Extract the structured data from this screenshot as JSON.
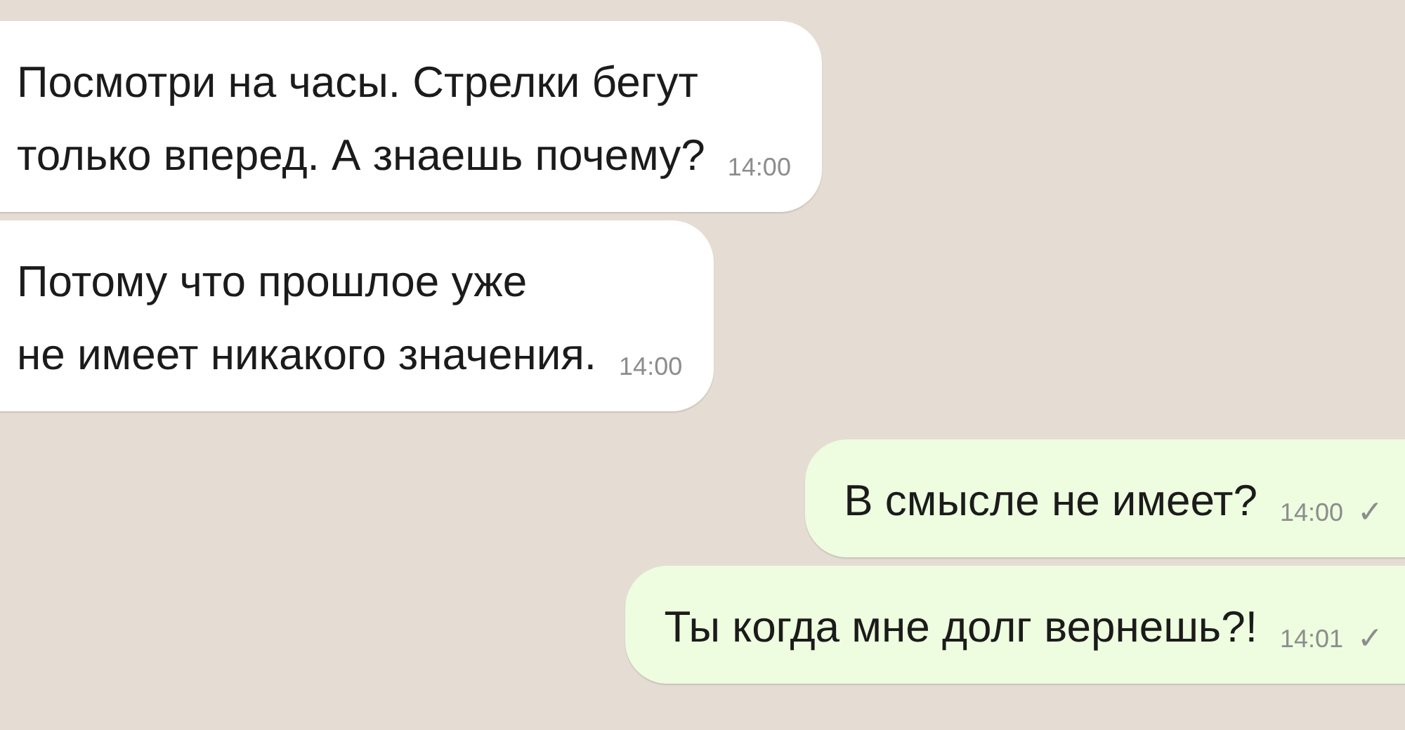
{
  "messages": [
    {
      "kind": "incoming",
      "lines": [
        "Посмотри на часы. Стрелки бегут",
        "только вперед. А знаешь почему?"
      ],
      "time": "14:00"
    },
    {
      "kind": "incoming",
      "lines": [
        "Потому что прошлое уже",
        "не имеет никакого значения."
      ],
      "time": "14:00"
    },
    {
      "kind": "outgoing",
      "lines": [
        "В смысле не имеет?"
      ],
      "time": "14:00",
      "status_mark": "✓"
    },
    {
      "kind": "outgoing",
      "lines": [
        "Ты когда мне долг вернешь?!"
      ],
      "time": "14:01",
      "status_mark": "✓"
    }
  ]
}
